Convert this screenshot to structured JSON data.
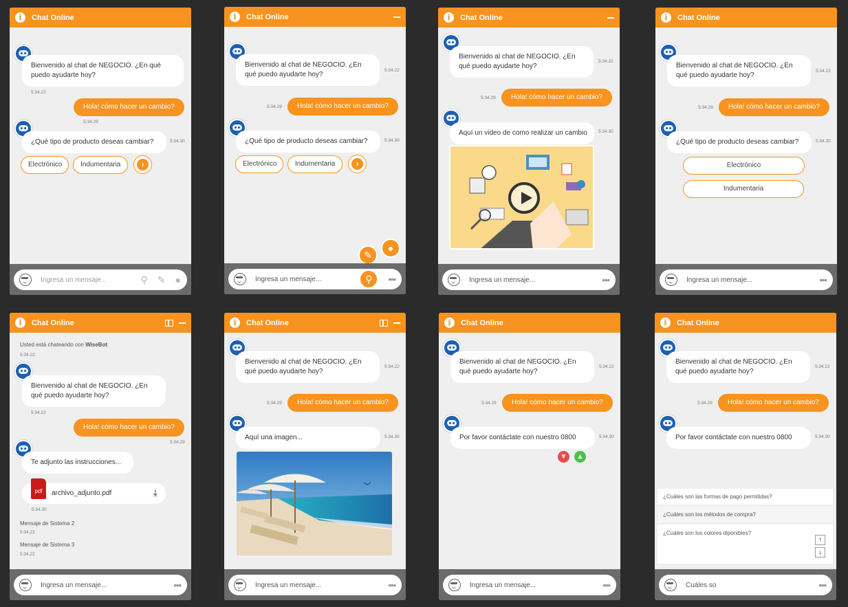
{
  "header": {
    "title": "Chat Online"
  },
  "input": {
    "placeholder": "Ingresa un mensaje...",
    "typed": "Cuáles so"
  },
  "messages": {
    "welcome": "Bienvenido al chat de NEGOCIO. ¿En qué puedo ayudarte hoy?",
    "user_question": "Hola! cómo hacer un cambio?",
    "product_question": "¿Qué tipo de producto deseas cambiar?",
    "video_text": "Aquí un video de como realizar un cambio",
    "image_text": "Aquí una imagen...",
    "contact_text": "Por favor contáctate con nuestro 0800",
    "attach_text": "Te adjunto las instrucciones...",
    "chatting_with_prefix": "Usted está chateando con",
    "bot_name": "WiseBot",
    "system_2": "Mensaje de Sistema 2",
    "system_3": "Mensaje de Sistema 3"
  },
  "timestamps": {
    "t22": "5:34.22",
    "t29": "5:34.29",
    "t30": "5:34.30"
  },
  "options": {
    "electronico": "Electrónico",
    "indumentaria": "Indumentaria"
  },
  "file": {
    "name": "archivo_adjunto.pdf",
    "icon_label": "pdf"
  },
  "suggestions": [
    "¿Cuáles son las formas de pago permitidas?",
    "¿Cuáles son los métodos de compra?",
    "¿Cuáles son los colores diponibles?"
  ],
  "colors": {
    "accent": "#f7931e",
    "background": "#2b2b2b",
    "panel": "#efefef",
    "footer": "#6b6b6b",
    "like": "#4cc04c",
    "dislike": "#e74c4c"
  },
  "icons": [
    "info-icon",
    "minimize-icon",
    "layout-icon",
    "bot-avatar-icon",
    "smile-icon",
    "location-icon",
    "attach-icon",
    "mic-icon",
    "more-icon",
    "chevron-right-icon",
    "download-icon",
    "play-icon",
    "thumbs-up-icon",
    "thumbs-down-icon",
    "arrow-up-icon",
    "arrow-down-icon"
  ]
}
